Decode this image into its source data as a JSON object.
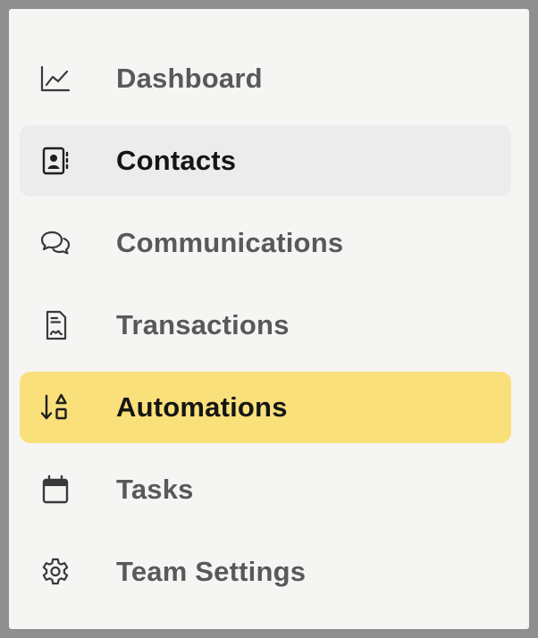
{
  "nav": {
    "items": [
      {
        "label": "Dashboard",
        "icon": "chart-line-icon",
        "state": "default"
      },
      {
        "label": "Contacts",
        "icon": "contact-card-icon",
        "state": "hover"
      },
      {
        "label": "Communications",
        "icon": "chat-bubbles-icon",
        "state": "default"
      },
      {
        "label": "Transactions",
        "icon": "document-icon",
        "state": "default"
      },
      {
        "label": "Automations",
        "icon": "sort-shapes-icon",
        "state": "selected"
      },
      {
        "label": "Tasks",
        "icon": "calendar-icon",
        "state": "default"
      },
      {
        "label": "Team Settings",
        "icon": "gear-icon",
        "state": "default"
      }
    ]
  },
  "colors": {
    "panel_bg": "#f5f5f3",
    "hover_bg": "#ececec",
    "selected_bg": "#f9e07a",
    "label_default": "#595959",
    "label_active": "#151515",
    "icon_color": "#3a3a3a"
  }
}
